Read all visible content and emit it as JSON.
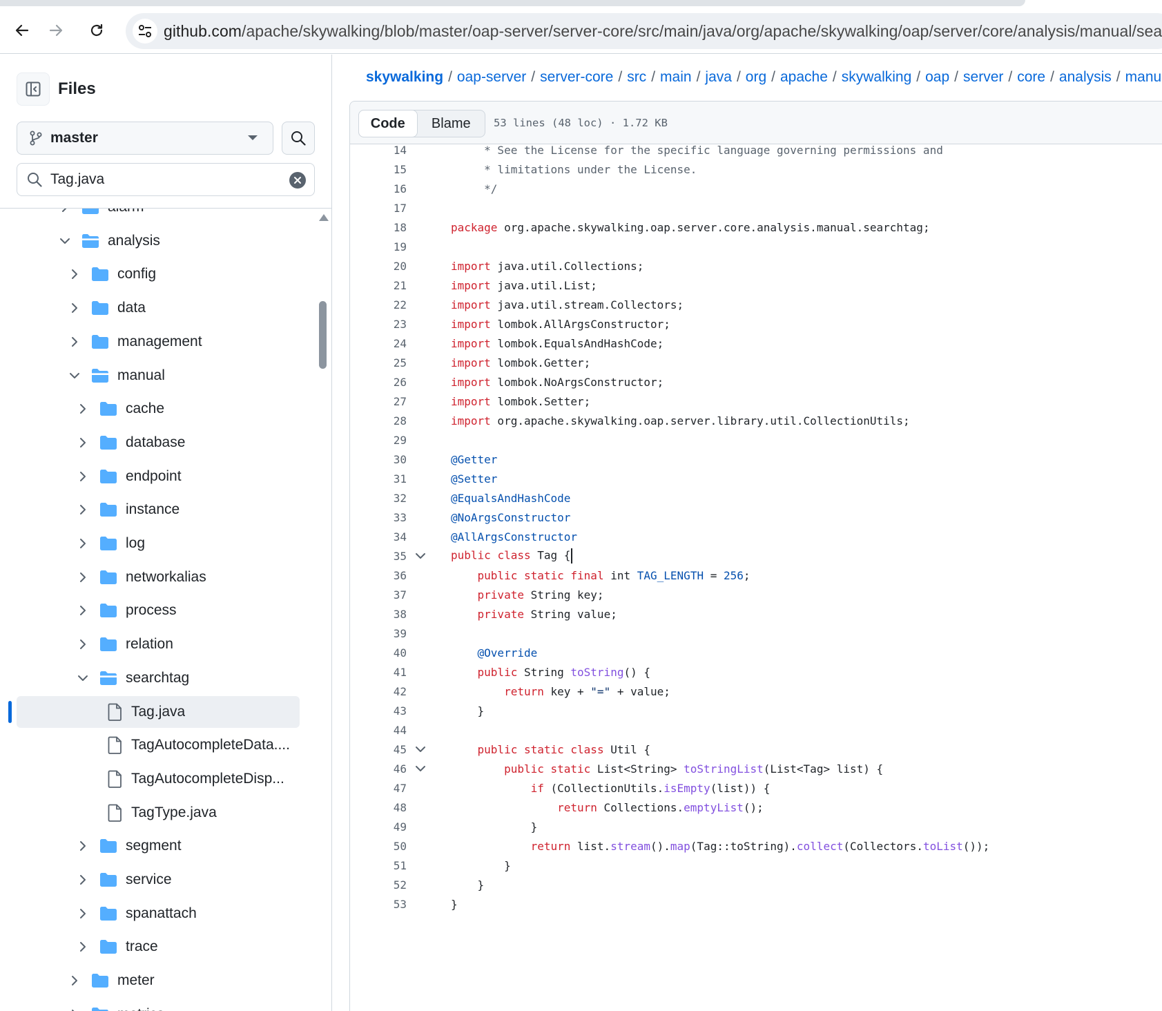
{
  "browser": {
    "url": "github.com/apache/skywalking/blob/master/oap-server/server-core/src/main/java/org/apache/skywalking/oap/server/core/analysis/manual/sea",
    "url_host": "github.com",
    "url_path": "/apache/skywalking/blob/master/oap-server/server-core/src/main/java/org/apache/skywalking/oap/server/core/analysis/manual/sea"
  },
  "sidebar": {
    "title": "Files",
    "branch": "master",
    "filter_value": "Tag.java",
    "tree": [
      {
        "label": "alarm",
        "kind": "folder",
        "depth": 1,
        "state": "collapsed",
        "clipped": true
      },
      {
        "label": "analysis",
        "kind": "folder",
        "depth": 1,
        "state": "expanded"
      },
      {
        "label": "config",
        "kind": "folder",
        "depth": 2,
        "state": "collapsed"
      },
      {
        "label": "data",
        "kind": "folder",
        "depth": 2,
        "state": "collapsed"
      },
      {
        "label": "management",
        "kind": "folder",
        "depth": 2,
        "state": "collapsed"
      },
      {
        "label": "manual",
        "kind": "folder",
        "depth": 2,
        "state": "expanded"
      },
      {
        "label": "cache",
        "kind": "folder",
        "depth": 3,
        "state": "collapsed"
      },
      {
        "label": "database",
        "kind": "folder",
        "depth": 3,
        "state": "collapsed"
      },
      {
        "label": "endpoint",
        "kind": "folder",
        "depth": 3,
        "state": "collapsed"
      },
      {
        "label": "instance",
        "kind": "folder",
        "depth": 3,
        "state": "collapsed"
      },
      {
        "label": "log",
        "kind": "folder",
        "depth": 3,
        "state": "collapsed"
      },
      {
        "label": "networkalias",
        "kind": "folder",
        "depth": 3,
        "state": "collapsed"
      },
      {
        "label": "process",
        "kind": "folder",
        "depth": 3,
        "state": "collapsed"
      },
      {
        "label": "relation",
        "kind": "folder",
        "depth": 3,
        "state": "collapsed"
      },
      {
        "label": "searchtag",
        "kind": "folder",
        "depth": 3,
        "state": "expanded"
      },
      {
        "label": "Tag.java",
        "kind": "file",
        "depth": 4,
        "selected": true
      },
      {
        "label": "TagAutocompleteData....",
        "kind": "file",
        "depth": 4
      },
      {
        "label": "TagAutocompleteDisp...",
        "kind": "file",
        "depth": 4
      },
      {
        "label": "TagType.java",
        "kind": "file",
        "depth": 4
      },
      {
        "label": "segment",
        "kind": "folder",
        "depth": 3,
        "state": "collapsed"
      },
      {
        "label": "service",
        "kind": "folder",
        "depth": 3,
        "state": "collapsed"
      },
      {
        "label": "spanattach",
        "kind": "folder",
        "depth": 3,
        "state": "collapsed"
      },
      {
        "label": "trace",
        "kind": "folder",
        "depth": 3,
        "state": "collapsed"
      },
      {
        "label": "meter",
        "kind": "folder",
        "depth": 2,
        "state": "collapsed"
      },
      {
        "label": "metrics",
        "kind": "folder",
        "depth": 2,
        "state": "collapsed"
      }
    ]
  },
  "breadcrumb": [
    "skywalking",
    "oap-server",
    "server-core",
    "src",
    "main",
    "java",
    "org",
    "apache",
    "skywalking",
    "oap",
    "server",
    "core",
    "analysis",
    "manual"
  ],
  "file_header": {
    "tab_code": "Code",
    "tab_blame": "Blame",
    "info": "53 lines (48 loc) · 1.72 KB"
  },
  "code_lines": [
    {
      "n": 14,
      "tokens": [
        [
          "c",
          "     * See the License for the specific language governing permissions and"
        ]
      ]
    },
    {
      "n": 15,
      "tokens": [
        [
          "c",
          "     * limitations under the License."
        ]
      ]
    },
    {
      "n": 16,
      "tokens": [
        [
          "c",
          "     */"
        ]
      ]
    },
    {
      "n": 17,
      "tokens": []
    },
    {
      "n": 18,
      "tokens": [
        [
          "k",
          "package"
        ],
        [
          "",
          " org.apache.skywalking.oap.server.core.analysis.manual.searchtag;"
        ]
      ]
    },
    {
      "n": 19,
      "tokens": []
    },
    {
      "n": 20,
      "tokens": [
        [
          "k",
          "import"
        ],
        [
          "",
          " java.util.Collections;"
        ]
      ]
    },
    {
      "n": 21,
      "tokens": [
        [
          "k",
          "import"
        ],
        [
          "",
          " java.util.List;"
        ]
      ]
    },
    {
      "n": 22,
      "tokens": [
        [
          "k",
          "import"
        ],
        [
          "",
          " java.util.stream.Collectors;"
        ]
      ]
    },
    {
      "n": 23,
      "tokens": [
        [
          "k",
          "import"
        ],
        [
          "",
          " lombok.AllArgsConstructor;"
        ]
      ]
    },
    {
      "n": 24,
      "tokens": [
        [
          "k",
          "import"
        ],
        [
          "",
          " lombok.EqualsAndHashCode;"
        ]
      ]
    },
    {
      "n": 25,
      "tokens": [
        [
          "k",
          "import"
        ],
        [
          "",
          " lombok.Getter;"
        ]
      ]
    },
    {
      "n": 26,
      "tokens": [
        [
          "k",
          "import"
        ],
        [
          "",
          " lombok.NoArgsConstructor;"
        ]
      ]
    },
    {
      "n": 27,
      "tokens": [
        [
          "k",
          "import"
        ],
        [
          "",
          " lombok.Setter;"
        ]
      ]
    },
    {
      "n": 28,
      "tokens": [
        [
          "k",
          "import"
        ],
        [
          "",
          " org.apache.skywalking.oap.server.library.util.CollectionUtils;"
        ]
      ]
    },
    {
      "n": 29,
      "tokens": []
    },
    {
      "n": 30,
      "tokens": [
        [
          "a",
          "@Getter"
        ]
      ]
    },
    {
      "n": 31,
      "tokens": [
        [
          "a",
          "@Setter"
        ]
      ]
    },
    {
      "n": 32,
      "tokens": [
        [
          "a",
          "@EqualsAndHashCode"
        ]
      ]
    },
    {
      "n": 33,
      "tokens": [
        [
          "a",
          "@NoArgsConstructor"
        ]
      ]
    },
    {
      "n": 34,
      "tokens": [
        [
          "a",
          "@AllArgsConstructor"
        ]
      ]
    },
    {
      "n": 35,
      "fold": true,
      "cursor": true,
      "tokens": [
        [
          "k",
          "public"
        ],
        [
          "",
          " "
        ],
        [
          "k",
          "class"
        ],
        [
          "",
          " Tag {"
        ]
      ]
    },
    {
      "n": 36,
      "tokens": [
        [
          "",
          "    "
        ],
        [
          "k",
          "public"
        ],
        [
          "",
          " "
        ],
        [
          "k",
          "static"
        ],
        [
          "",
          " "
        ],
        [
          "k",
          "final"
        ],
        [
          "",
          " int "
        ],
        [
          "a",
          "TAG_LENGTH"
        ],
        [
          "",
          " = "
        ],
        [
          "a",
          "256"
        ],
        [
          "",
          ";"
        ]
      ]
    },
    {
      "n": 37,
      "tokens": [
        [
          "",
          "    "
        ],
        [
          "k",
          "private"
        ],
        [
          "",
          " String key;"
        ]
      ]
    },
    {
      "n": 38,
      "tokens": [
        [
          "",
          "    "
        ],
        [
          "k",
          "private"
        ],
        [
          "",
          " String value;"
        ]
      ]
    },
    {
      "n": 39,
      "tokens": []
    },
    {
      "n": 40,
      "tokens": [
        [
          "",
          "    "
        ],
        [
          "a",
          "@Override"
        ]
      ]
    },
    {
      "n": 41,
      "tokens": [
        [
          "",
          "    "
        ],
        [
          "k",
          "public"
        ],
        [
          "",
          " String "
        ],
        [
          "f",
          "toString"
        ],
        [
          "",
          "() {"
        ]
      ]
    },
    {
      "n": 42,
      "tokens": [
        [
          "",
          "        "
        ],
        [
          "k",
          "return"
        ],
        [
          "",
          " key + "
        ],
        [
          "s",
          "\"=\""
        ],
        [
          "",
          " + value;"
        ]
      ]
    },
    {
      "n": 43,
      "tokens": [
        [
          "",
          "    }"
        ]
      ]
    },
    {
      "n": 44,
      "tokens": []
    },
    {
      "n": 45,
      "fold": true,
      "tokens": [
        [
          "",
          "    "
        ],
        [
          "k",
          "public"
        ],
        [
          "",
          " "
        ],
        [
          "k",
          "static"
        ],
        [
          "",
          " "
        ],
        [
          "k",
          "class"
        ],
        [
          "",
          " Util {"
        ]
      ]
    },
    {
      "n": 46,
      "fold": true,
      "tokens": [
        [
          "",
          "        "
        ],
        [
          "k",
          "public"
        ],
        [
          "",
          " "
        ],
        [
          "k",
          "static"
        ],
        [
          "",
          " List<String> "
        ],
        [
          "f",
          "toStringList"
        ],
        [
          "",
          "(List<Tag> list) {"
        ]
      ]
    },
    {
      "n": 47,
      "tokens": [
        [
          "",
          "            "
        ],
        [
          "k",
          "if"
        ],
        [
          "",
          " (CollectionUtils."
        ],
        [
          "f",
          "isEmpty"
        ],
        [
          "",
          "(list)) {"
        ]
      ]
    },
    {
      "n": 48,
      "tokens": [
        [
          "",
          "                "
        ],
        [
          "k",
          "return"
        ],
        [
          "",
          " Collections."
        ],
        [
          "f",
          "emptyList"
        ],
        [
          "",
          "();"
        ]
      ]
    },
    {
      "n": 49,
      "tokens": [
        [
          "",
          "            }"
        ]
      ]
    },
    {
      "n": 50,
      "tokens": [
        [
          "",
          "            "
        ],
        [
          "k",
          "return"
        ],
        [
          "",
          " list."
        ],
        [
          "f",
          "stream"
        ],
        [
          "",
          "()."
        ],
        [
          "f",
          "map"
        ],
        [
          "",
          "(Tag::toString)."
        ],
        [
          "f",
          "collect"
        ],
        [
          "",
          "(Collectors."
        ],
        [
          "f",
          "toList"
        ],
        [
          "",
          "());"
        ]
      ]
    },
    {
      "n": 51,
      "tokens": [
        [
          "",
          "        }"
        ]
      ]
    },
    {
      "n": 52,
      "tokens": [
        [
          "",
          "    }"
        ]
      ]
    },
    {
      "n": 53,
      "tokens": [
        [
          "",
          "}"
        ]
      ]
    }
  ],
  "colors": {
    "link": "#0969da",
    "keyword": "#cf222e",
    "annotation": "#0550ae",
    "function": "#8250df",
    "string": "#0a3069",
    "folder": "#54aeff",
    "selected_marker": "#0969da"
  }
}
